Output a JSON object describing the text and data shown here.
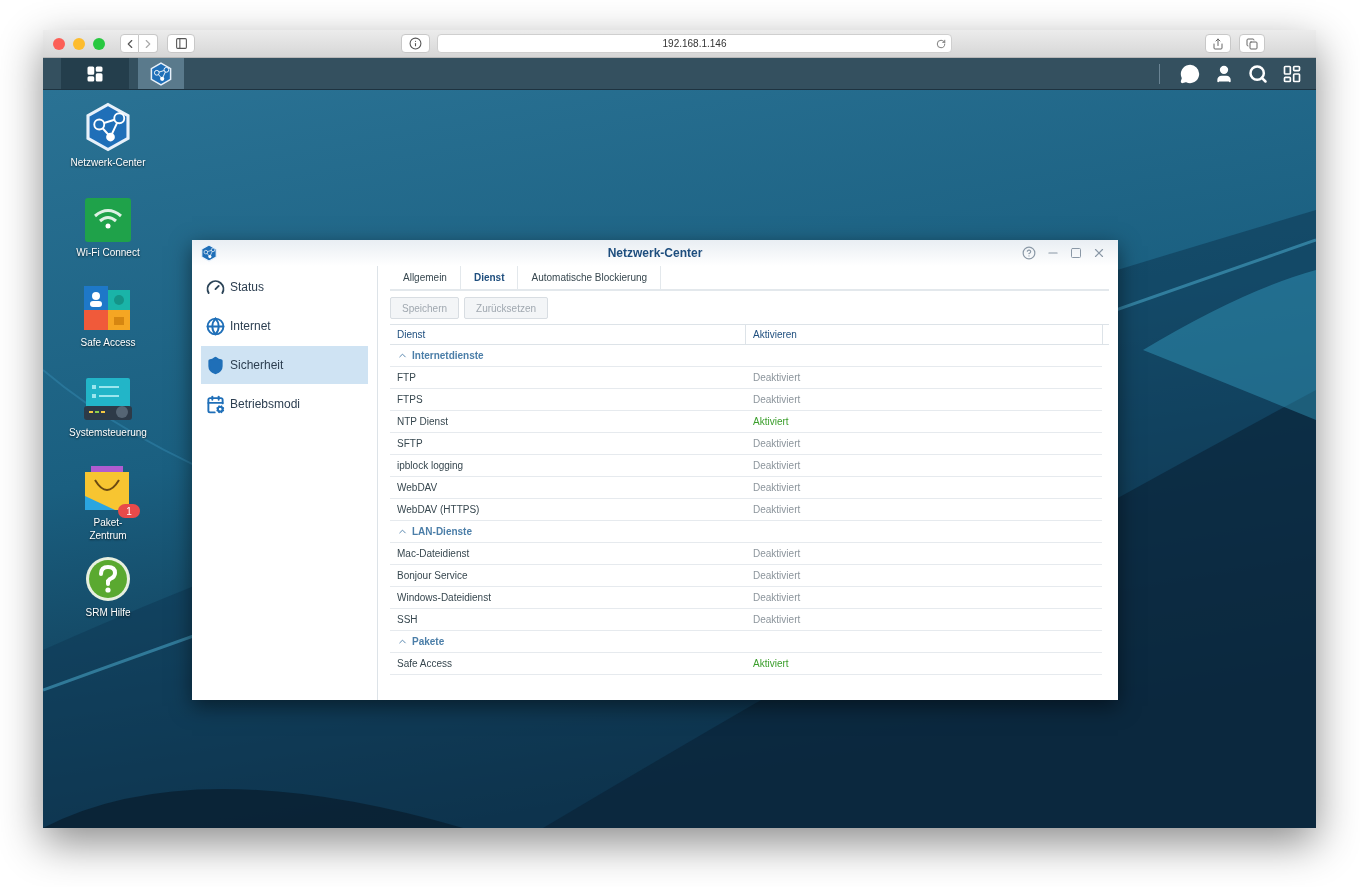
{
  "browser": {
    "url": "192.168.1.146"
  },
  "taskbar": {
    "items": [
      {
        "kind": "main-menu",
        "selected": false
      },
      {
        "kind": "network-center",
        "selected": true
      }
    ]
  },
  "desktop_icons": [
    {
      "kind": "network",
      "label": "Netzwerk-Center"
    },
    {
      "kind": "wifi",
      "label": "Wi-Fi Connect"
    },
    {
      "kind": "safe",
      "label": "Safe Access"
    },
    {
      "kind": "control",
      "label": "Systemsteuerung"
    },
    {
      "kind": "package",
      "label": "Paket-\nZentrum",
      "badge": "1"
    },
    {
      "kind": "help",
      "label": "SRM Hilfe"
    }
  ],
  "window": {
    "title": "Netzwerk-Center",
    "sidebar": {
      "items": [
        {
          "kind": "status",
          "label": "Status",
          "selected": false
        },
        {
          "kind": "internet",
          "label": "Internet",
          "selected": false
        },
        {
          "kind": "security",
          "label": "Sicherheit",
          "selected": true
        },
        {
          "kind": "modes",
          "label": "Betriebsmodi",
          "selected": false
        }
      ]
    },
    "tabs": [
      {
        "label": "Allgemein",
        "selected": false
      },
      {
        "label": "Dienst",
        "selected": true
      },
      {
        "label": "Automatische Blockierung",
        "selected": false
      }
    ],
    "buttons": [
      {
        "label": "Speichern",
        "disabled": true
      },
      {
        "label": "Zurücksetzen",
        "disabled": true
      }
    ],
    "table": {
      "columns": [
        "Dienst",
        "Aktivieren"
      ],
      "groups": [
        {
          "title": "Internetdienste",
          "expanded": true,
          "rows": [
            {
              "service": "FTP",
              "status": "Deaktiviert",
              "active": false
            },
            {
              "service": "FTPS",
              "status": "Deaktiviert",
              "active": false
            },
            {
              "service": "NTP Dienst",
              "status": "Aktiviert",
              "active": true
            },
            {
              "service": "SFTP",
              "status": "Deaktiviert",
              "active": false
            },
            {
              "service": "ipblock logging",
              "status": "Deaktiviert",
              "active": false
            },
            {
              "service": "WebDAV",
              "status": "Deaktiviert",
              "active": false
            },
            {
              "service": "WebDAV (HTTPS)",
              "status": "Deaktiviert",
              "active": false
            }
          ]
        },
        {
          "title": "LAN-Dienste",
          "expanded": true,
          "rows": [
            {
              "service": "Mac-Dateidienst",
              "status": "Deaktiviert",
              "active": false
            },
            {
              "service": "Bonjour Service",
              "status": "Deaktiviert",
              "active": false
            },
            {
              "service": "Windows-Dateidienst",
              "status": "Deaktiviert",
              "active": false
            },
            {
              "service": "SSH",
              "status": "Deaktiviert",
              "active": false
            }
          ]
        },
        {
          "title": "Pakete",
          "expanded": true,
          "rows": [
            {
              "service": "Safe Access",
              "status": "Aktiviert",
              "active": true
            }
          ]
        }
      ]
    }
  }
}
